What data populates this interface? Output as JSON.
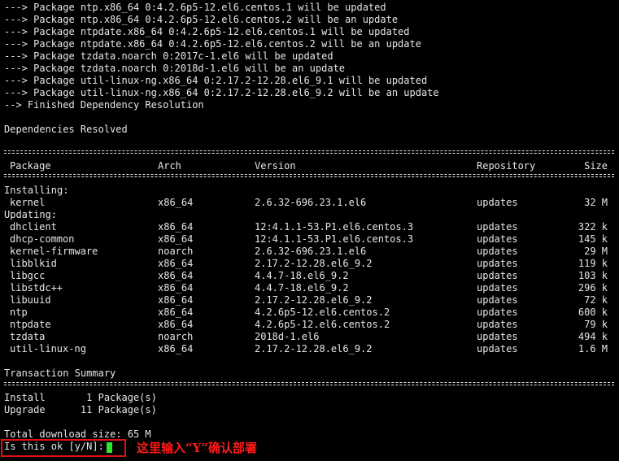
{
  "log_lines": [
    "---> Package ntp.x86_64 0:4.2.6p5-12.el6.centos.1 will be updated",
    "---> Package ntp.x86_64 0:4.2.6p5-12.el6.centos.2 will be an update",
    "---> Package ntpdate.x86_64 0:4.2.6p5-12.el6.centos.1 will be updated",
    "---> Package ntpdate.x86_64 0:4.2.6p5-12.el6.centos.2 will be an update",
    "---> Package tzdata.noarch 0:2017c-1.el6 will be updated",
    "---> Package tzdata.noarch 0:2018d-1.el6 will be an update",
    "---> Package util-linux-ng.x86_64 0:2.17.2-12.28.el6_9.1 will be updated",
    "---> Package util-linux-ng.x86_64 0:2.17.2-12.28.el6_9.2 will be an update",
    "--> Finished Dependency Resolution"
  ],
  "dependencies_resolved": "Dependencies Resolved",
  "table": {
    "headers": {
      "package": "Package",
      "arch": "Arch",
      "version": "Version",
      "repository": "Repository",
      "size": "Size"
    },
    "installing_label": "Installing:",
    "updating_label": "Updating:",
    "installing": [
      {
        "package": "kernel",
        "arch": "x86_64",
        "version": "2.6.32-696.23.1.el6",
        "repository": "updates",
        "size": "32 M"
      }
    ],
    "updating": [
      {
        "package": "dhclient",
        "arch": "x86_64",
        "version": "12:4.1.1-53.P1.el6.centos.3",
        "repository": "updates",
        "size": "322 k"
      },
      {
        "package": "dhcp-common",
        "arch": "x86_64",
        "version": "12:4.1.1-53.P1.el6.centos.3",
        "repository": "updates",
        "size": "145 k"
      },
      {
        "package": "kernel-firmware",
        "arch": "noarch",
        "version": "2.6.32-696.23.1.el6",
        "repository": "updates",
        "size": "29 M"
      },
      {
        "package": "libblkid",
        "arch": "x86_64",
        "version": "2.17.2-12.28.el6_9.2",
        "repository": "updates",
        "size": "119 k"
      },
      {
        "package": "libgcc",
        "arch": "x86_64",
        "version": "4.4.7-18.el6_9.2",
        "repository": "updates",
        "size": "103 k"
      },
      {
        "package": "libstdc++",
        "arch": "x86_64",
        "version": "4.4.7-18.el6_9.2",
        "repository": "updates",
        "size": "296 k"
      },
      {
        "package": "libuuid",
        "arch": "x86_64",
        "version": "2.17.2-12.28.el6_9.2",
        "repository": "updates",
        "size": "72 k"
      },
      {
        "package": "ntp",
        "arch": "x86_64",
        "version": "4.2.6p5-12.el6.centos.2",
        "repository": "updates",
        "size": "600 k"
      },
      {
        "package": "ntpdate",
        "arch": "x86_64",
        "version": "4.2.6p5-12.el6.centos.2",
        "repository": "updates",
        "size": "79 k"
      },
      {
        "package": "tzdata",
        "arch": "noarch",
        "version": "2018d-1.el6",
        "repository": "updates",
        "size": "494 k"
      },
      {
        "package": "util-linux-ng",
        "arch": "x86_64",
        "version": "2.17.2-12.28.el6_9.2",
        "repository": "updates",
        "size": "1.6 M"
      }
    ]
  },
  "summary": {
    "title": "Transaction Summary",
    "install": "Install       1 Package(s)",
    "upgrade": "Upgrade      11 Package(s)"
  },
  "total_download": "Total download size: 65 M",
  "prompt": "Is this ok [y/N]:",
  "annotation": "这里输入“Y”确认部署",
  "colors": {
    "background": "#000000",
    "text": "#e6e6e6",
    "cursor": "#2ee62e",
    "highlight": "#e01010",
    "annotation": "#ff1a1a"
  }
}
